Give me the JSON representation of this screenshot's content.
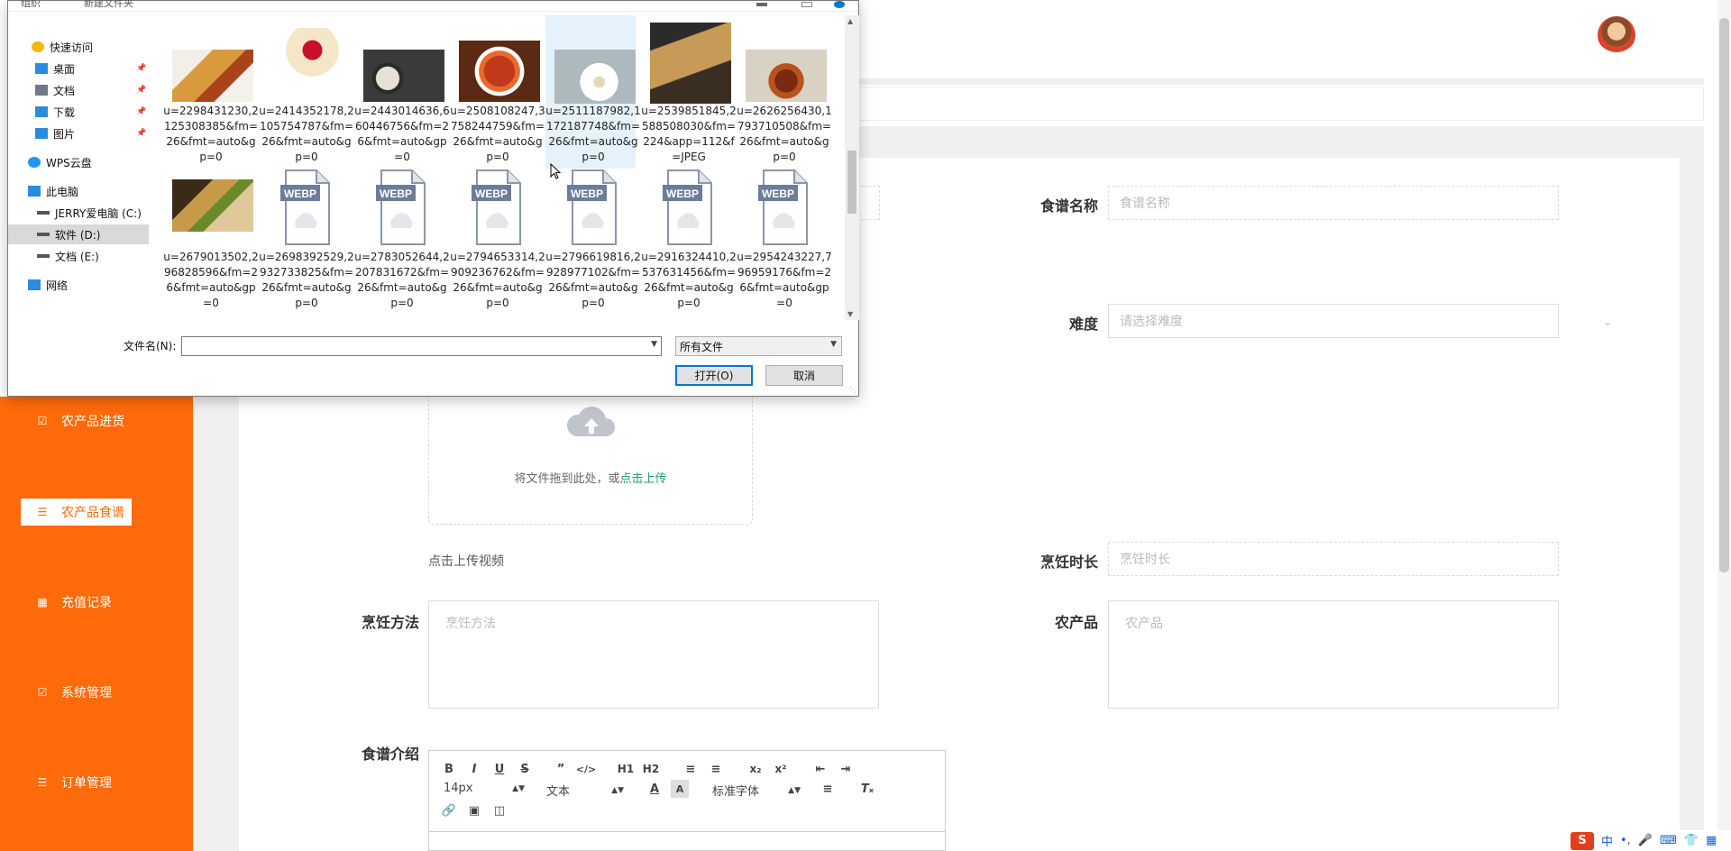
{
  "dialog": {
    "toolbar_ghost": [
      "组织",
      "新建文件夹"
    ],
    "nav": [
      {
        "label": "快速访问",
        "icon": "star-icon",
        "pinned": false
      },
      {
        "label": "桌面",
        "icon": "desktop-folder-icon",
        "pinned": true
      },
      {
        "label": "文档",
        "icon": "documents-folder-icon",
        "pinned": true
      },
      {
        "label": "下载",
        "icon": "download-arrow-icon",
        "pinned": true
      },
      {
        "label": "图片",
        "icon": "pictures-folder-icon",
        "pinned": true
      },
      {
        "label": "WPS云盘",
        "icon": "cloud-icon",
        "pinned": false
      },
      {
        "label": "此电脑",
        "icon": "computer-icon",
        "pinned": false
      },
      {
        "label": "JERRY爱电脑 (C:)",
        "icon": "drive-icon",
        "pinned": false
      },
      {
        "label": "软件 (D:)",
        "icon": "drive-icon",
        "pinned": false
      },
      {
        "label": "文档 (E:)",
        "icon": "drive-icon",
        "pinned": false
      },
      {
        "label": "网络",
        "icon": "network-icon",
        "pinned": false
      }
    ],
    "files": [
      {
        "name": "u=2298431230,2125308385&fm=26&fmt=auto&gp=0",
        "kind": "photo"
      },
      {
        "name": "u=2414352178,2105754787&fm=26&fmt=auto&gp=0",
        "kind": "photo"
      },
      {
        "name": "u=2443014636,660446756&fm=26&fmt=auto&gp=0",
        "kind": "photo"
      },
      {
        "name": "u=2508108247,3758244759&fm=26&fmt=auto&gp=0",
        "kind": "photo"
      },
      {
        "name": "u=2511187982,1172187748&fm=26&fmt=auto&gp=0",
        "kind": "photo"
      },
      {
        "name": "u=2539851845,2588508030&fm=224&app=112&f=JPEG",
        "kind": "photo"
      },
      {
        "name": "u=2626256430,1793710508&fm=26&fmt=auto&gp=0",
        "kind": "photo"
      },
      {
        "name": "u=2679013502,296828596&fm=26&fmt=auto&gp=0",
        "kind": "photo"
      },
      {
        "name": "u=2698392529,2932733825&fm=26&fmt=auto&gp=0",
        "kind": "webp"
      },
      {
        "name": "u=2783052644,2207831672&fm=26&fmt=auto&gp=0",
        "kind": "webp"
      },
      {
        "name": "u=2794653314,2909236762&fm=26&fmt=auto&gp=0",
        "kind": "webp"
      },
      {
        "name": "u=2796619816,2928977102&fm=26&fmt=auto&gp=0",
        "kind": "webp"
      },
      {
        "name": "u=2916324410,2537631456&fm=26&fmt=auto&gp=0",
        "kind": "webp"
      },
      {
        "name": "u=2954243227,796959176&fm=26&fmt=auto&gp=0",
        "kind": "webp"
      }
    ],
    "webp_badge": "WEBP",
    "filename_label": "文件名(N):",
    "filename_value": "",
    "filetype_value": "所有文件",
    "open_label": "打开(O)",
    "cancel_label": "取消"
  },
  "sidebar": {
    "items": [
      {
        "label": "农产品进货",
        "icon": "clipboard-check-icon"
      },
      {
        "label": "农产品食谱",
        "icon": "sliders-icon"
      },
      {
        "label": "充值记录",
        "icon": "clipboard-icon"
      },
      {
        "label": "系统管理",
        "icon": "checkbox-icon"
      },
      {
        "label": "订单管理",
        "icon": "list-icon"
      }
    ]
  },
  "form": {
    "recipe_name_label": "食谱名称",
    "recipe_name_placeholder": "食谱名称",
    "difficulty_label": "难度",
    "difficulty_placeholder": "请选择难度",
    "upload_hint": "将文件拖到此处，或",
    "upload_link": "点击上传",
    "video_label": "点击上传视频",
    "cook_time_label": "烹饪时长",
    "cook_time_placeholder": "烹饪时长",
    "method_label": "烹饪方法",
    "method_placeholder": "烹饪方法",
    "product_label": "农产品",
    "product_placeholder": "农产品",
    "intro_label": "食谱介绍"
  },
  "editor": {
    "font_size": "14px",
    "paragraph": "文本",
    "font_family": "标准字体"
  },
  "tray": {
    "ime_label": "中"
  },
  "colors": {
    "sidebar": "#ff6a0a",
    "link": "#1f9e6e",
    "dialog_accent": "#0078d7"
  }
}
